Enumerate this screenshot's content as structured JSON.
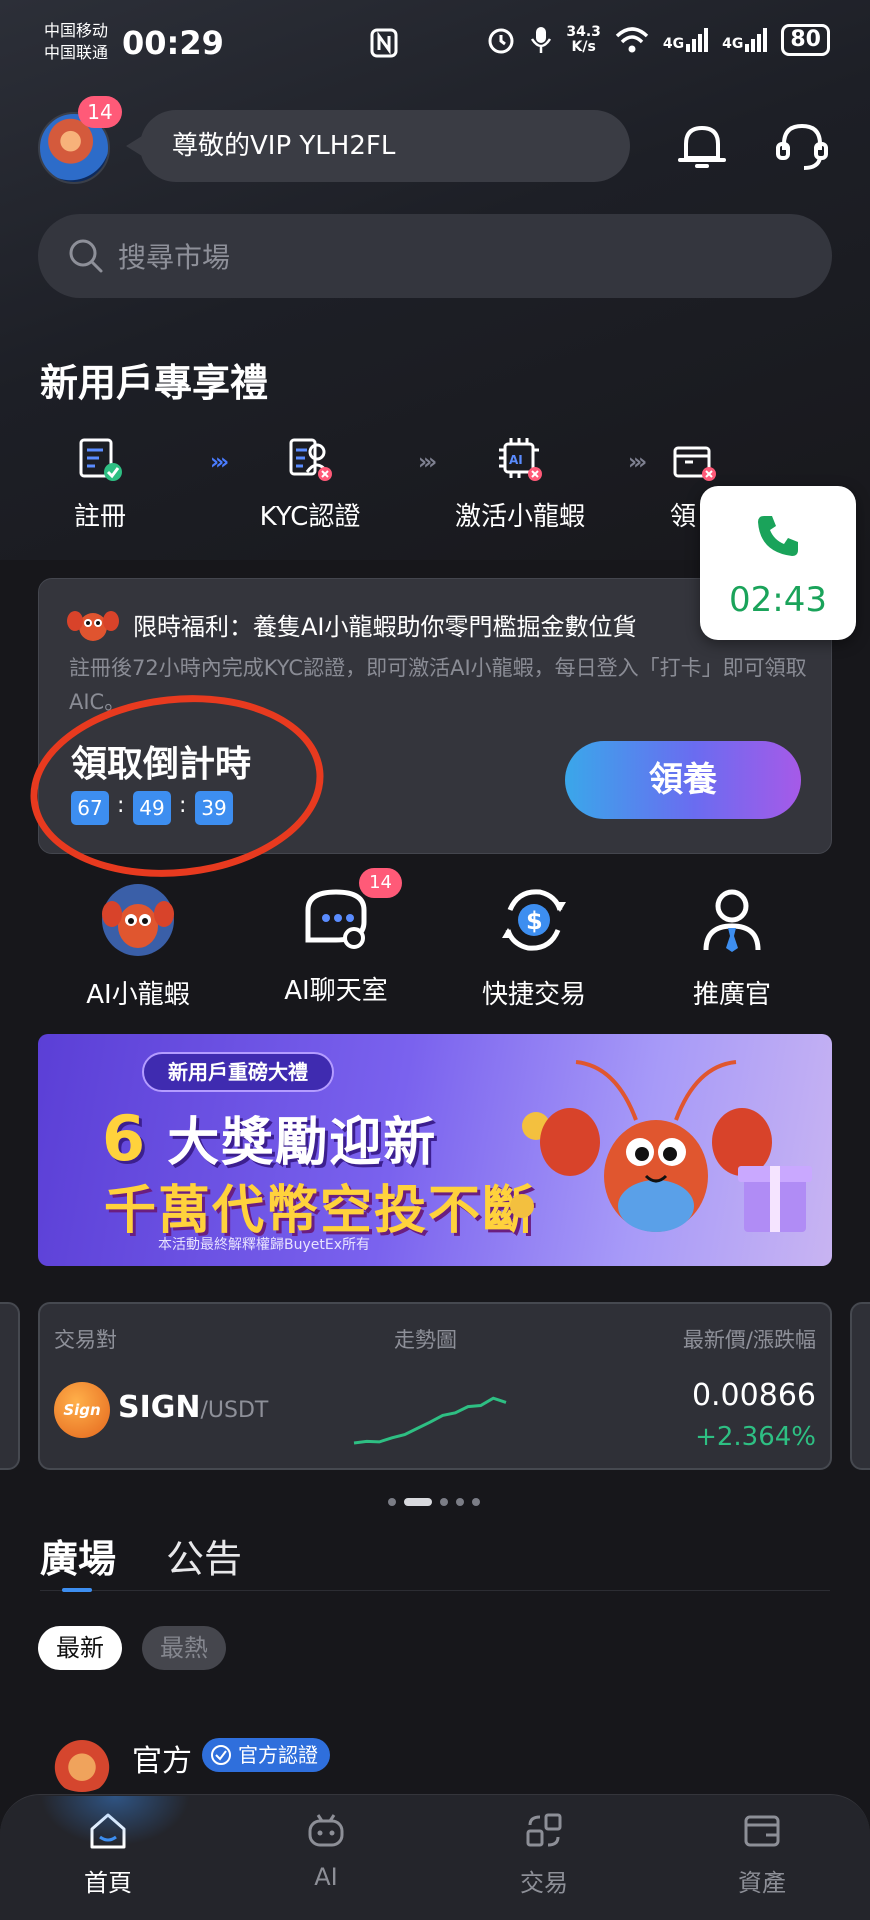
{
  "status_bar": {
    "carrier_1": "中国移动",
    "carrier_2": "中国联通",
    "time": "00:29",
    "net_speed_value": "34.3",
    "net_speed_unit": "K/s",
    "signal_1": "4G",
    "signal_2": "4G",
    "battery": "80"
  },
  "header": {
    "avatar_badge": "14",
    "greeting": "尊敬的VIP YLH2FL"
  },
  "search": {
    "placeholder": "搜尋市場"
  },
  "newcomer": {
    "title": "新用戶專享禮",
    "steps": [
      {
        "label": "註冊",
        "icon": "register-icon",
        "status": "done"
      },
      {
        "label": "KYC認證",
        "icon": "kyc-icon",
        "status": "pending"
      },
      {
        "label": "激活小龍蝦",
        "icon": "ai-chip-icon",
        "status": "pending"
      },
      {
        "label": "領",
        "icon": "gift-box-icon",
        "status": "pending"
      }
    ]
  },
  "call_overlay": {
    "duration": "02:43"
  },
  "promo": {
    "title": "限時福利：養隻AI小龍蝦助你零門檻掘金數位貨",
    "description": "註冊後72小時內完成KYC認證，即可激活AI小龍蝦，每日登入「打卡」即可領取AIC。",
    "countdown_label": "領取倒計時",
    "countdown_h": "67",
    "countdown_m": "49",
    "countdown_s": "39",
    "countdown_sep": ":",
    "button": "領養"
  },
  "quick_entries": [
    {
      "label": "AI小龍蝦",
      "icon": "lobster-icon"
    },
    {
      "label": "AI聊天室",
      "icon": "chat-room-icon",
      "badge": "14"
    },
    {
      "label": "快捷交易",
      "icon": "quick-trade-icon"
    },
    {
      "label": "推廣官",
      "icon": "promoter-icon"
    }
  ],
  "banner": {
    "chip": "新用戶重磅大禮",
    "line1_num": "6",
    "line1_text": "大獎勵迎新",
    "line2": "千萬代幣空投不斷",
    "footnote": "本活動最終解釋權歸BuyetEx所有"
  },
  "market": {
    "col_pair": "交易對",
    "col_trend": "走勢圖",
    "col_price": "最新價/漲跌幅",
    "coin_logo": "Sign",
    "base": "SIGN",
    "quote": "/USDT",
    "price": "0.00866",
    "change": "+2.364%",
    "trend_points": [
      0.02,
      0.05,
      0.04,
      0.12,
      0.18,
      0.3,
      0.42,
      0.55,
      0.6,
      0.72,
      0.74,
      0.88,
      0.8
    ],
    "trend_color": "#2ebf83"
  },
  "plaza": {
    "tab_plaza": "廣場",
    "tab_notice": "公告",
    "chip_latest": "最新",
    "chip_hot": "最熱",
    "post_author": "官方",
    "post_badge": "官方認證"
  },
  "bottom_nav": [
    {
      "label": "首頁",
      "icon": "home-icon",
      "active": true
    },
    {
      "label": "AI",
      "icon": "ai-bot-icon",
      "active": false
    },
    {
      "label": "交易",
      "icon": "trade-icon",
      "active": false
    },
    {
      "label": "資產",
      "icon": "wallet-icon",
      "active": false
    }
  ],
  "colors": {
    "accent_blue": "#3d8ef0",
    "badge_pink": "#ff5a78",
    "up_green": "#2ebf83",
    "annotation_red": "#e83a1f"
  }
}
